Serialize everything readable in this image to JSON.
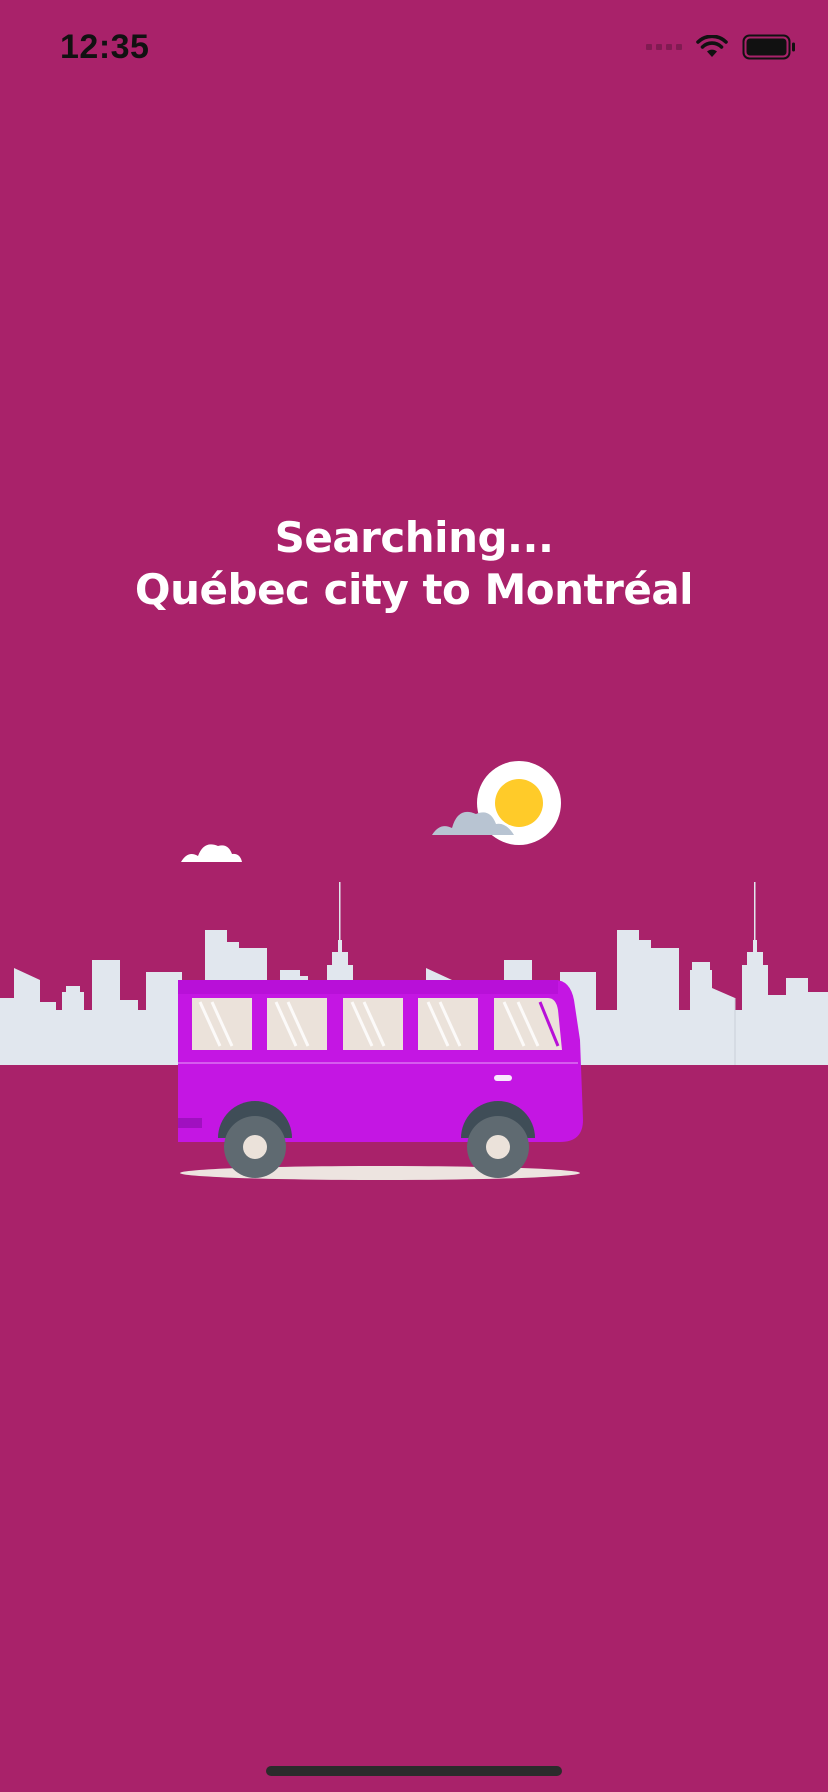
{
  "status_bar": {
    "time": "12:35",
    "icons": [
      "signal-icon",
      "wifi-icon",
      "battery-icon"
    ]
  },
  "search": {
    "line1": "Searching...",
    "line2": "Québec city to Montréal"
  },
  "colors": {
    "background": "#a9226a",
    "bus": "#c416e3",
    "skyline": "#e1e7ee",
    "sun": "#ffcb29"
  },
  "illustration": {
    "icons": [
      "skyline-illustration",
      "bus-illustration",
      "sun-icon",
      "cloud-icon"
    ]
  }
}
